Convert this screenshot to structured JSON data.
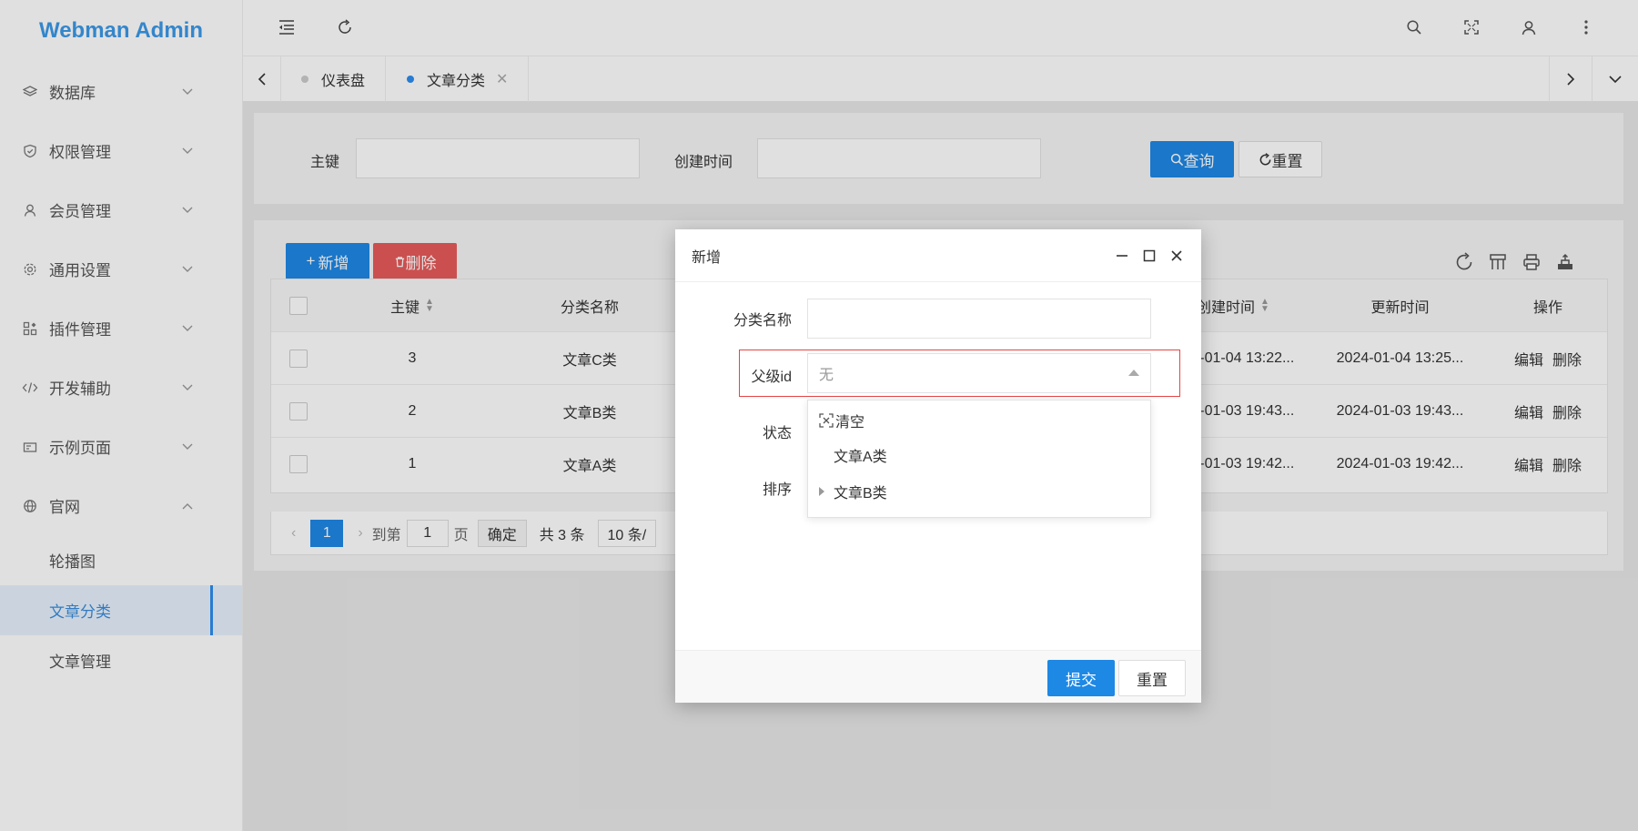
{
  "app": {
    "title": "Webman Admin"
  },
  "sidebar": {
    "items": [
      {
        "label": "数据库",
        "icon": "layers-icon"
      },
      {
        "label": "权限管理",
        "icon": "shield-icon"
      },
      {
        "label": "会员管理",
        "icon": "user-icon"
      },
      {
        "label": "通用设置",
        "icon": "gear-icon"
      },
      {
        "label": "插件管理",
        "icon": "apps-icon"
      },
      {
        "label": "开发辅助",
        "icon": "code-icon"
      },
      {
        "label": "示例页面",
        "icon": "template-icon"
      },
      {
        "label": "官网",
        "icon": "globe-icon"
      }
    ],
    "subitems": [
      {
        "label": "轮播图"
      },
      {
        "label": "文章分类"
      },
      {
        "label": "文章管理"
      }
    ]
  },
  "tabs": [
    {
      "label": "仪表盘"
    },
    {
      "label": "文章分类"
    }
  ],
  "search": {
    "id_label": "主键",
    "created_label": "创建时间",
    "query_label": "查询",
    "reset_label": "重置"
  },
  "toolbar": {
    "add_label": "新增",
    "delete_label": "删除"
  },
  "table": {
    "headers": {
      "id": "主键",
      "name": "分类名称",
      "created": "创建时间",
      "updated": "更新时间",
      "actions": "操作"
    },
    "rows": [
      {
        "id": "3",
        "name": "文章C类",
        "created": "2024-01-04 13:22...",
        "updated": "2024-01-04 13:25..."
      },
      {
        "id": "2",
        "name": "文章B类",
        "created": "2024-01-03 19:43...",
        "updated": "2024-01-03 19:43..."
      },
      {
        "id": "1",
        "name": "文章A类",
        "created": "2024-01-03 19:42...",
        "updated": "2024-01-03 19:42..."
      }
    ],
    "edit_label": "编辑",
    "delete_label": "删除"
  },
  "pager": {
    "current": "1",
    "goto_label": "到第",
    "goto_value": "1",
    "page_label": "页",
    "confirm_label": "确定",
    "total_label": "共 3 条",
    "size_label": "10 条/"
  },
  "modal": {
    "title": "新增",
    "name_label": "分类名称",
    "parent_label": "父级id",
    "parent_value": "无",
    "status_label": "状态",
    "order_label": "排序",
    "dropdown": {
      "clear_label": "清空",
      "options": [
        {
          "label": "文章A类"
        },
        {
          "label": "文章B类"
        }
      ]
    },
    "submit_label": "提交",
    "reset_label": "重置"
  },
  "colors": {
    "primary": "#1e88e5",
    "danger": "#e85a5a",
    "brand": "#3b99e8",
    "error_border": "#e54545"
  }
}
